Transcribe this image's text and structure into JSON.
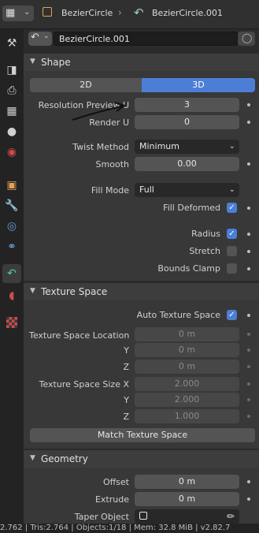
{
  "header": {
    "object_name": "BezierCircle",
    "data_name": "BezierCircle.001"
  },
  "object_row": {
    "datablock_name": "BezierCircle.001"
  },
  "shape": {
    "title": "Shape",
    "dim_2d": "2D",
    "dim_3d": "3D",
    "resolution_preview_label": "Resolution Preview U",
    "resolution_preview_value": "3",
    "render_u_label": "Render U",
    "render_u_value": "0",
    "twist_method_label": "Twist Method",
    "twist_method_value": "Minimum",
    "smooth_label": "Smooth",
    "smooth_value": "0.00",
    "fill_mode_label": "Fill Mode",
    "fill_mode_value": "Full",
    "fill_deformed_label": "Fill Deformed",
    "radius_label": "Radius",
    "stretch_label": "Stretch",
    "bounds_clamp_label": "Bounds Clamp"
  },
  "texture_space": {
    "title": "Texture Space",
    "auto_label": "Auto Texture Space",
    "location_label": "Texture Space Location",
    "y_label": "Y",
    "z_label": "Z",
    "loc_x": "0 m",
    "loc_y": "0 m",
    "loc_z": "0 m",
    "size_label": "Texture Space Size X",
    "size_x": "2.000",
    "size_y": "2.000",
    "size_z": "1.000",
    "match_button": "Match Texture Space"
  },
  "geometry": {
    "title": "Geometry",
    "offset_label": "Offset",
    "offset_value": "0 m",
    "extrude_label": "Extrude",
    "extrude_value": "0 m",
    "taper_label": "Taper Object"
  },
  "status_bar": {
    "text": "2.762 | Tris:2.764 | Objects:1/18 | Mem: 32.8 MiB | v2.82.7"
  },
  "colors": {
    "accent": "#4c7ed6",
    "panel": "#383838",
    "header": "#3d3d3d",
    "field": "#545454"
  }
}
